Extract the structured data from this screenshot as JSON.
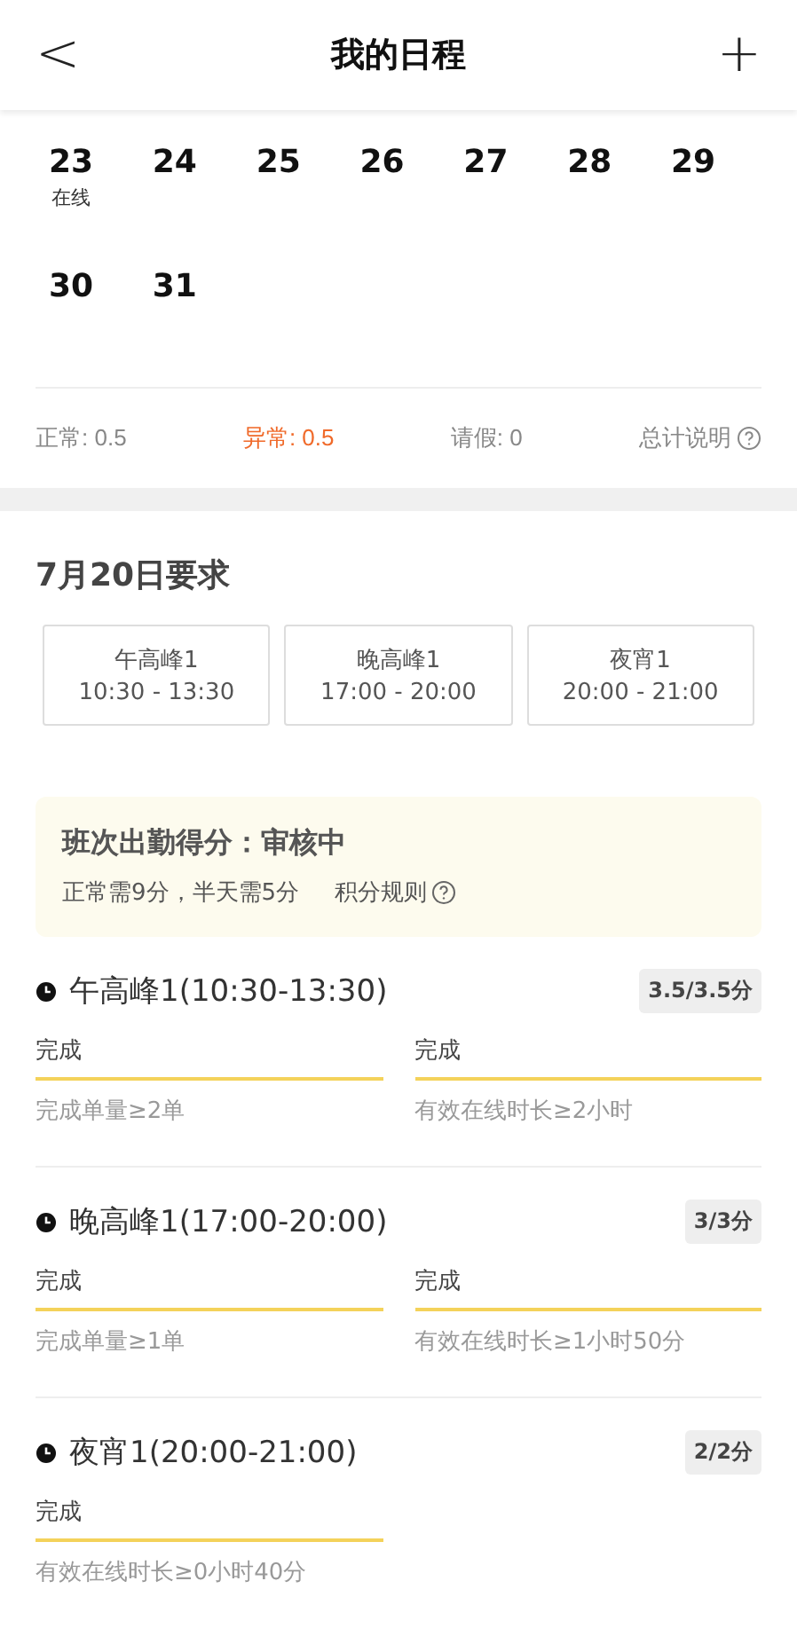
{
  "header": {
    "back": "<",
    "title": "我的日程",
    "add": "+"
  },
  "calendar": {
    "weeks": [
      [
        {
          "day": "23",
          "note": "在线"
        },
        {
          "day": "24"
        },
        {
          "day": "25"
        },
        {
          "day": "26"
        },
        {
          "day": "27"
        },
        {
          "day": "28"
        },
        {
          "day": "29"
        }
      ],
      [
        {
          "day": "30"
        },
        {
          "day": "31"
        }
      ]
    ]
  },
  "stats": [
    {
      "label": "正常: 0.5",
      "kind": "normal"
    },
    {
      "label": "异常: 0.5",
      "kind": "alert"
    },
    {
      "label": "请假: 0",
      "kind": "normal"
    }
  ],
  "stats_help": "总计说明",
  "requirements": {
    "title": "7月20日要求",
    "shifts": [
      {
        "name": "午高峰1",
        "time": "10:30 - 13:30"
      },
      {
        "name": "晚高峰1",
        "time": "17:00 - 20:00"
      },
      {
        "name": "夜宵1",
        "time": "20:00 - 21:00"
      }
    ]
  },
  "notice": {
    "title": "班次出勤得分：审核中",
    "text": "正常需9分，半天需5分",
    "link": "积分规则"
  },
  "details": [
    {
      "title": "午高峰1(10:30-13:30)",
      "score": "3.5/3.5分",
      "items": [
        {
          "status": "完成",
          "rule": "完成单量≥2单"
        },
        {
          "status": "完成",
          "rule": "有效在线时长≥2小时"
        }
      ]
    },
    {
      "title": "晚高峰1(17:00-20:00)",
      "score": "3/3分",
      "items": [
        {
          "status": "完成",
          "rule": "完成单量≥1单"
        },
        {
          "status": "完成",
          "rule": "有效在线时长≥1小时50分"
        }
      ]
    },
    {
      "title": "夜宵1(20:00-21:00)",
      "score": "2/2分",
      "items": [
        {
          "status": "完成",
          "rule": "有效在线时长≥0小时40分"
        }
      ]
    }
  ]
}
